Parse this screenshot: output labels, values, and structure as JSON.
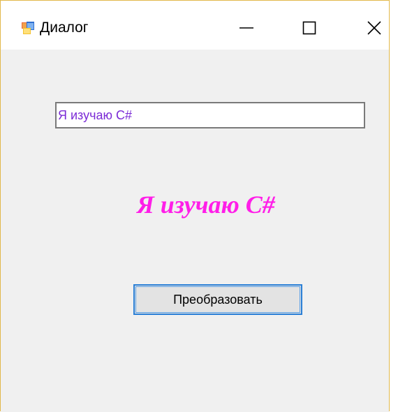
{
  "window": {
    "title": "Диалог",
    "icon": "windows-form-icon",
    "controls": {
      "minimize_icon": "minimize-icon",
      "maximize_icon": "maximize-icon",
      "close_icon": "close-icon"
    }
  },
  "form": {
    "textbox_value": "Я изучаю C#",
    "label_text": "Я изучаю C#",
    "label_color": "#ff1ee8",
    "textbox_text_color": "#7b2bd6",
    "button_label": "Преобразовать"
  }
}
